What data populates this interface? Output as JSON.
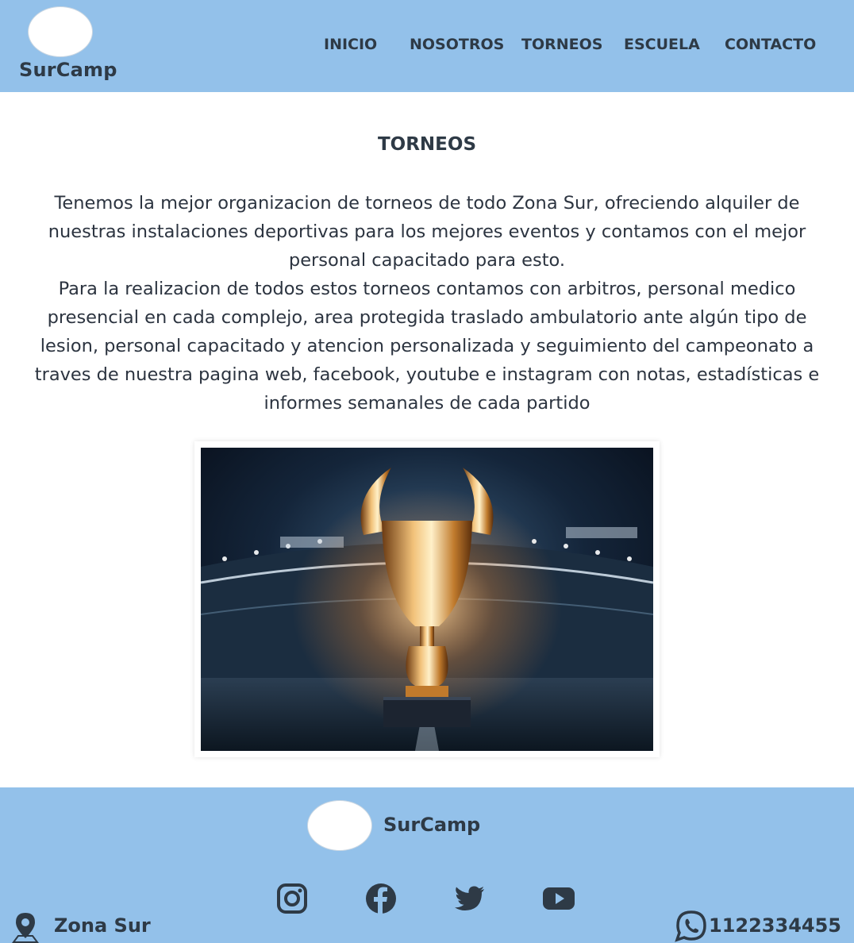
{
  "header": {
    "brand": "SurCamp",
    "nav": [
      "INICIO",
      "NOSOTROS",
      "TORNEOS",
      "ESCUELA",
      "CONTACTO"
    ]
  },
  "main": {
    "title": "TORNEOS",
    "paragraph_1": "Tenemos la mejor organizacion de torneos de todo Zona Sur, ofreciendo alquiler de nuestras instalaciones deportivas para los mejores eventos y contamos con el mejor personal capacitado para esto.",
    "paragraph_2": "Para la realizacion de todos estos torneos contamos con arbitros, personal medico presencial en cada complejo, area protegida traslado ambulatorio ante algún tipo de lesion, personal capacitado y atencion personalizada y seguimiento del campeonato a traves de nuestra pagina web, facebook, youtube e instagram con notas, estadísticas e informes semanales de cada partido",
    "image": "trophy-in-stadium"
  },
  "footer": {
    "brand": "SurCamp",
    "social_icons": [
      "instagram-icon",
      "facebook-icon",
      "twitter-icon",
      "youtube-icon"
    ],
    "location": "Zona Sur",
    "phone": "1122334455"
  },
  "colors": {
    "header_bg": "#93c1ea",
    "footer_bg": "#93c1ea",
    "text": "#2e3a46"
  }
}
